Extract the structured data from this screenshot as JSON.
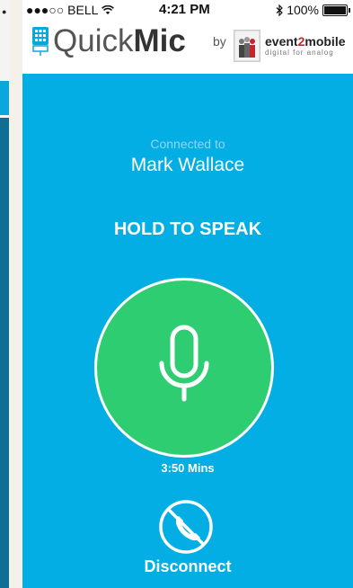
{
  "status_bar": {
    "carrier": "●●●○○ BELL",
    "time": "4:21 PM",
    "battery": "100%"
  },
  "header": {
    "app_name_light": "Quick",
    "app_name_bold": "Mic",
    "by": "by",
    "brand_name_a": "event",
    "brand_name_num": "2",
    "brand_name_b": "mobile",
    "brand_tagline": "digital for analog"
  },
  "call": {
    "connected_label": "Connected to",
    "contact_name": "Mark Wallace",
    "hold_label": "HOLD TO SPEAK",
    "timer": "3:50 Mins",
    "disconnect_label": "Disconnect"
  },
  "colors": {
    "background": "#02aee3",
    "mic_button": "#2ecd72",
    "header": "#ffffff"
  },
  "icons": {
    "mic": "microphone-icon",
    "disconnect": "phone-slash-icon",
    "wifi": "wifi-icon",
    "bluetooth": "bluetooth-icon",
    "battery": "battery-icon"
  }
}
